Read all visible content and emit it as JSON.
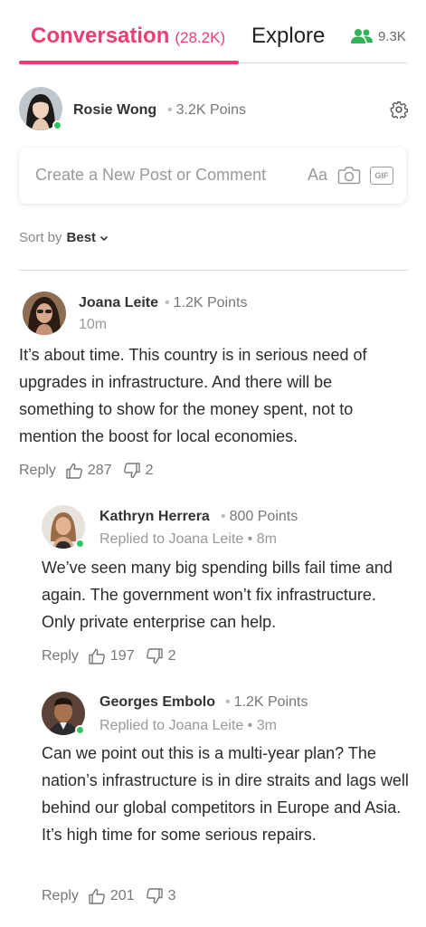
{
  "tabs": {
    "conversation_label": "Conversation",
    "conversation_count": "(28.2K)",
    "explore_label": "Explore",
    "users_count": "9.3K"
  },
  "current_user": {
    "name": "Rosie Wong",
    "points": "3.2K Poins"
  },
  "composer": {
    "placeholder": "Create a New Post or Comment",
    "format_label": "Aa",
    "gif_label": "GIF"
  },
  "sort": {
    "label": "Sort by",
    "value": "Best"
  },
  "comments": [
    {
      "name": "Joana Leite",
      "points": "1.2K Points",
      "meta": "10m",
      "body": "It’s about time. This country is in serious need of upgrades in infrastructure. And there will be something to show for the money spent, not to mention the boost for local economies.",
      "reply_label": "Reply",
      "likes": "287",
      "dislikes": "2"
    },
    {
      "name": "Kathryn Herrera",
      "points": "800 Points",
      "meta": "Replied to Joana Leite • 8m",
      "body": "We’ve seen many big spending bills fail time and again. The government won’t fix infrastructure. Only private enterprise can help.",
      "reply_label": "Reply",
      "likes": "197",
      "dislikes": "2"
    },
    {
      "name": "Georges Embolo",
      "points": "1.2K Points",
      "meta": "Replied to Joana Leite • 3m",
      "body": "Can we point out this is a multi-year plan? The nation’s infrastructure is in dire straits and lags well behind our global competitors in Europe and Asia. It’s high time for some serious repairs.",
      "reply_label": "Reply",
      "likes": "201",
      "dislikes": "3"
    }
  ],
  "colors": {
    "accent": "#ec3e72",
    "online": "#2fc55c",
    "users_icon": "#2fb457"
  }
}
